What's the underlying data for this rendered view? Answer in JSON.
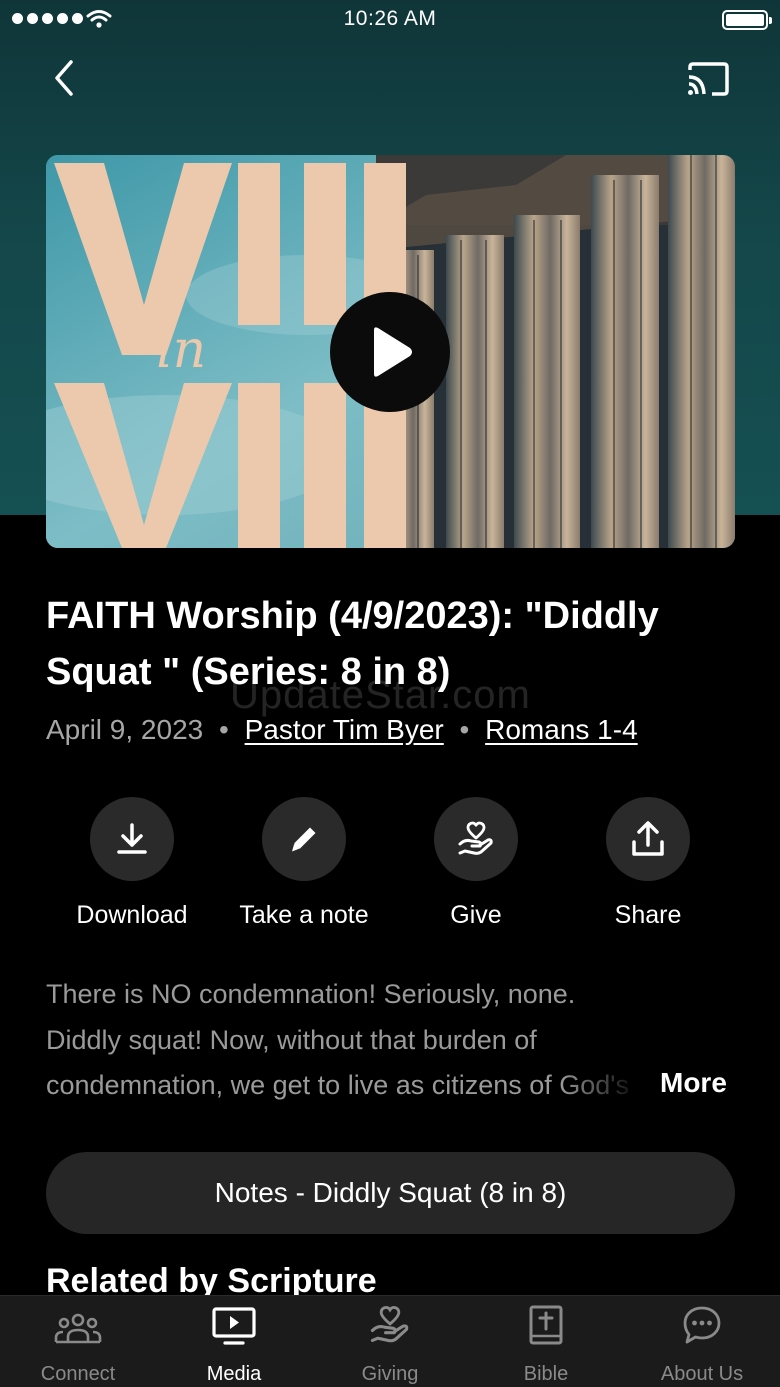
{
  "status_bar": {
    "time": "10:26 AM"
  },
  "header": {
    "back_icon": "chevron-left-icon",
    "cast_icon": "cast-icon"
  },
  "artwork": {
    "text_top": "VIII",
    "text_middle": "in",
    "text_bottom": "VIII",
    "play_icon": "play-icon"
  },
  "media": {
    "title": "FAITH Worship (4/9/2023): \"Diddly Squat \" (Series: 8 in 8)",
    "date": "April 9, 2023",
    "separator": "•",
    "speaker": "Pastor Tim Byer",
    "scripture": "Romans 1-4"
  },
  "watermark": "UpdateStar.com",
  "actions": [
    {
      "label": "Download",
      "icon": "download-icon"
    },
    {
      "label": "Take a note",
      "icon": "pencil-icon"
    },
    {
      "label": "Give",
      "icon": "giving-hand-icon"
    },
    {
      "label": "Share",
      "icon": "share-icon"
    }
  ],
  "description": {
    "text": "There is NO condemnation! Seriously, none. Diddly squat! Now, without that burden of condemnation, we get to live as citizens of God's kingdom.",
    "more_label": "More"
  },
  "notes_button": {
    "label": "Notes - Diddly Squat (8 in 8)"
  },
  "related": {
    "heading": "Related by Scripture"
  },
  "tabbar": {
    "active": "Media",
    "items": [
      {
        "label": "Connect",
        "icon": "people-icon"
      },
      {
        "label": "Media",
        "icon": "tv-play-icon"
      },
      {
        "label": "Giving",
        "icon": "giving-hand-icon"
      },
      {
        "label": "Bible",
        "icon": "bible-icon"
      },
      {
        "label": "About Us",
        "icon": "chat-bubble-icon"
      }
    ]
  },
  "colors": {
    "header_gradient_top": "#0f3538",
    "header_gradient_bottom": "#155052",
    "background": "#000000",
    "button_surface": "#2a2a2a",
    "muted_text": "#a6a6a6",
    "art_letters": "#ecc9ad"
  }
}
